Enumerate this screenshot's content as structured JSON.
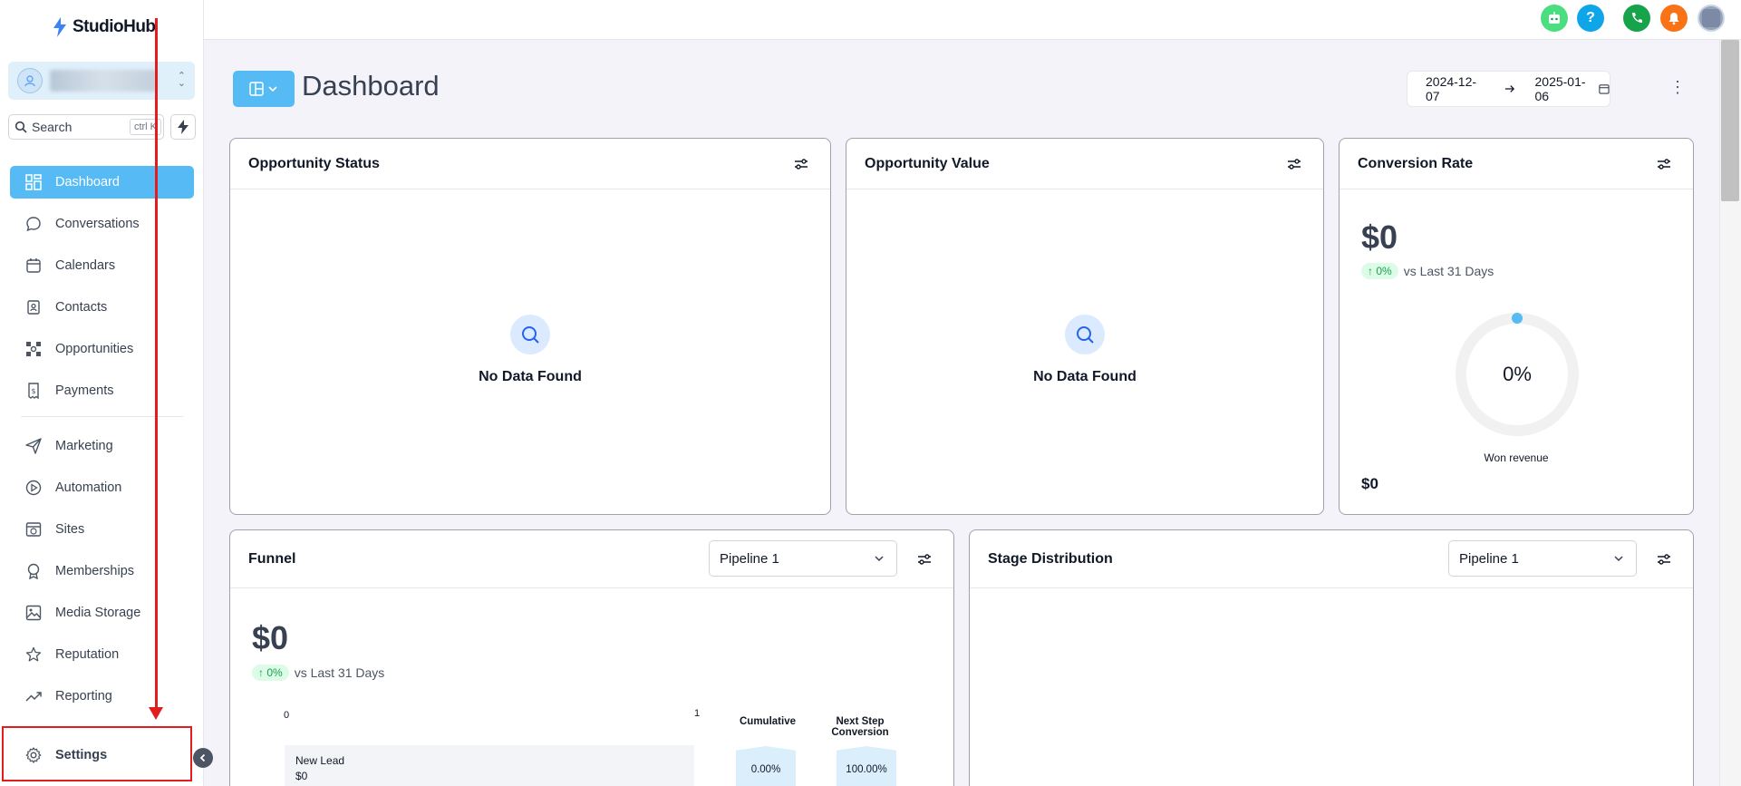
{
  "app": {
    "name": "StudioHub"
  },
  "sidebar": {
    "search": {
      "placeholder": "Search",
      "shortcut": "ctrl K"
    },
    "nav_primary": [
      {
        "label": "Dashboard",
        "icon": "grid-icon",
        "active": true
      },
      {
        "label": "Conversations",
        "icon": "chat-bubble-icon"
      },
      {
        "label": "Calendars",
        "icon": "calendar-icon"
      },
      {
        "label": "Contacts",
        "icon": "contact-book-icon"
      },
      {
        "label": "Opportunities",
        "icon": "opportunities-icon"
      },
      {
        "label": "Payments",
        "icon": "receipt-icon"
      }
    ],
    "nav_secondary": [
      {
        "label": "Marketing",
        "icon": "send-icon"
      },
      {
        "label": "Automation",
        "icon": "automation-icon"
      },
      {
        "label": "Sites",
        "icon": "globe-window-icon"
      },
      {
        "label": "Memberships",
        "icon": "award-icon"
      },
      {
        "label": "Media Storage",
        "icon": "image-icon"
      },
      {
        "label": "Reputation",
        "icon": "star-icon"
      },
      {
        "label": "Reporting",
        "icon": "trend-up-icon"
      }
    ],
    "settings_label": "Settings"
  },
  "header": {
    "title": "Dashboard",
    "date_from": "2024-12-07",
    "date_to": "2025-01-06",
    "icons": [
      "bot-icon",
      "help-icon",
      "phone-icon",
      "bell-icon",
      "avatar"
    ]
  },
  "cards": {
    "opportunity_status": {
      "title": "Opportunity Status",
      "empty_text": "No Data Found"
    },
    "opportunity_value": {
      "title": "Opportunity Value",
      "empty_text": "No Data Found"
    },
    "conversion_rate": {
      "title": "Conversion Rate",
      "value": "$0",
      "trend": "0%",
      "trend_label": "vs Last 31 Days",
      "gauge_percent_label": "0%",
      "gauge_percent": 0,
      "gauge_caption": "Won revenue",
      "footer_value": "$0"
    },
    "funnel": {
      "title": "Funnel",
      "pipeline": "Pipeline 1",
      "value": "$0",
      "trend": "0%",
      "trend_label": "vs Last 31 Days",
      "axis_min": "0",
      "axis_max": "1",
      "col_cumulative": "Cumulative",
      "col_next_step_1": "Next Step",
      "col_next_step_2": "Conversion",
      "rows": [
        {
          "stage": "New Lead",
          "value": "$0",
          "cumulative": "0.00%",
          "next_step": "100.00%"
        }
      ]
    },
    "stage_distribution": {
      "title": "Stage Distribution",
      "pipeline": "Pipeline 1"
    }
  },
  "colors": {
    "accent": "#56baf5",
    "annotation": "#e11d1d"
  }
}
